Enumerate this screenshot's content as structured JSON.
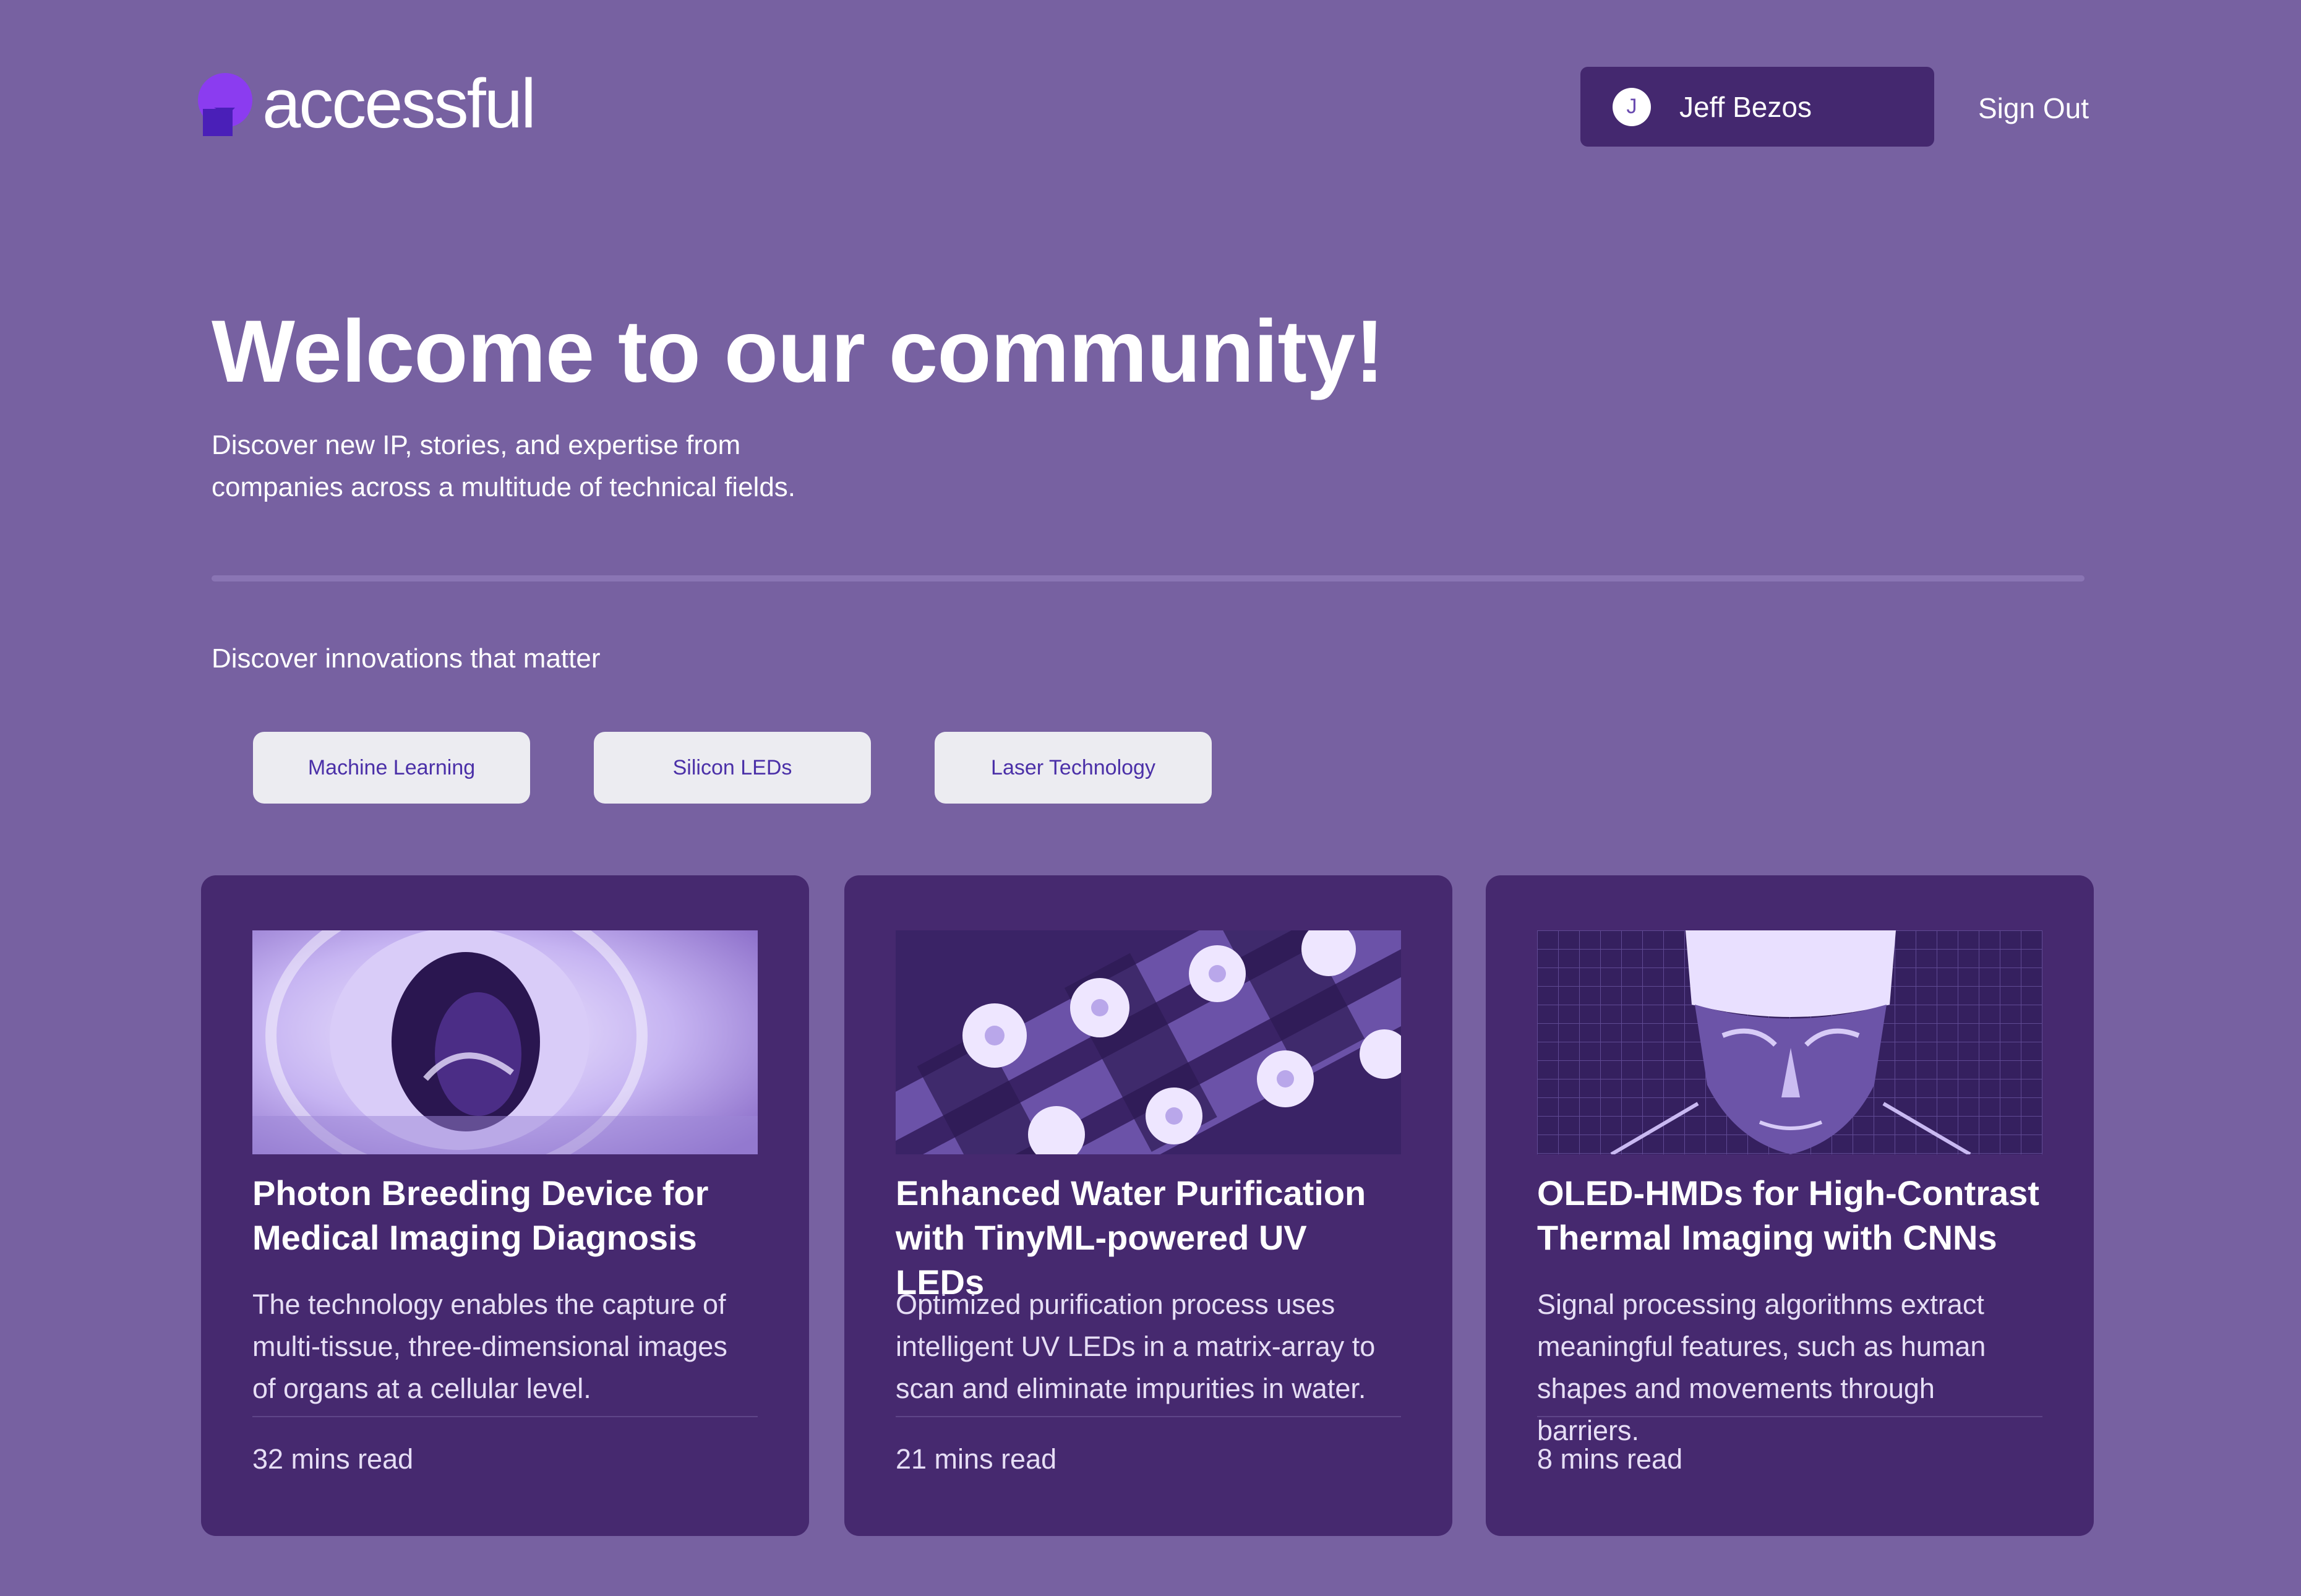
{
  "header": {
    "logo_text": "accessful",
    "logo_icon": "accessful-logo-icon",
    "user": {
      "initial": "J",
      "name": "Jeff Bezos"
    },
    "sign_out": "Sign Out"
  },
  "hero": {
    "title": "Welcome to our community!",
    "subtitle": "Discover new IP, stories, and expertise from companies across a multitude of technical fields."
  },
  "discover": {
    "heading": "Discover innovations that matter",
    "chips": [
      "Machine Learning",
      "Silicon LEDs",
      "Laser Technology"
    ]
  },
  "cards": [
    {
      "title": "Photon Breeding Device for Medical Imaging Diagnosis",
      "description": "The technology enables the capture of multi-tissue, three-dimensional images of organs at a cellular level.",
      "read_time": "32 mins read",
      "image": "mri-scanner-image"
    },
    {
      "title": "Enhanced Water Purification with TinyML-powered UV LEDs",
      "description": "Optimized purification process uses intelligent UV LEDs in a matrix-array to scan and eliminate impurities in water.",
      "read_time": "21 mins read",
      "image": "led-matrix-image"
    },
    {
      "title": "OLED-HMDs for High-Contrast Thermal Imaging with CNNs",
      "description": "Signal processing algorithms extract meaningful features, such as human shapes and movements through barriers.",
      "read_time": "8 mins read",
      "image": "thermal-face-image"
    }
  ],
  "colors": {
    "background": "#7761a1",
    "card": "#46296f",
    "chip_bg": "#ececf1",
    "chip_text": "#4b30a8",
    "brand": "#7c3aed"
  }
}
